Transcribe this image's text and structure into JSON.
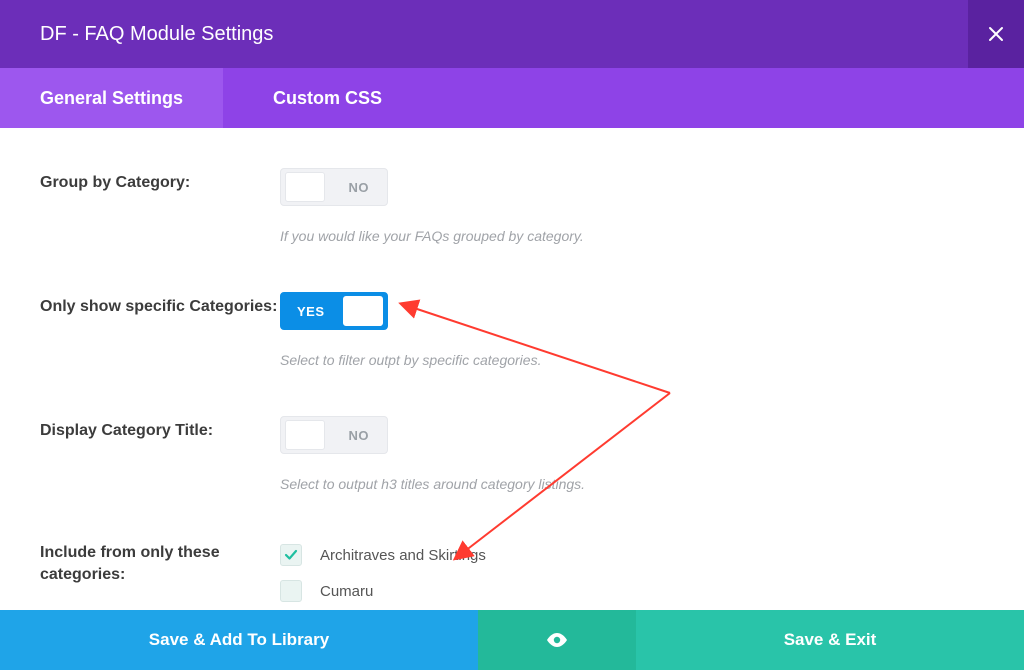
{
  "header": {
    "title": "DF - FAQ Module Settings"
  },
  "tabs": {
    "general": "General Settings",
    "custom": "Custom CSS"
  },
  "fields": {
    "group_by_category": {
      "label": "Group by Category:",
      "toggle_text": "NO",
      "help": "If you would like your FAQs grouped by category."
    },
    "only_specific": {
      "label": "Only show specific Categories:",
      "toggle_text": "YES",
      "help": "Select to filter outpt by specific categories."
    },
    "display_title": {
      "label": "Display Category Title:",
      "toggle_text": "NO",
      "help": "Select to output h3 titles around category listings."
    },
    "include_from": {
      "label": "Include from only these categories:",
      "items": [
        {
          "label": "Architraves and Skirtings",
          "checked": true
        },
        {
          "label": "Cumaru",
          "checked": false
        }
      ]
    }
  },
  "footer": {
    "save_library": "Save & Add To Library",
    "save_exit": "Save & Exit"
  }
}
